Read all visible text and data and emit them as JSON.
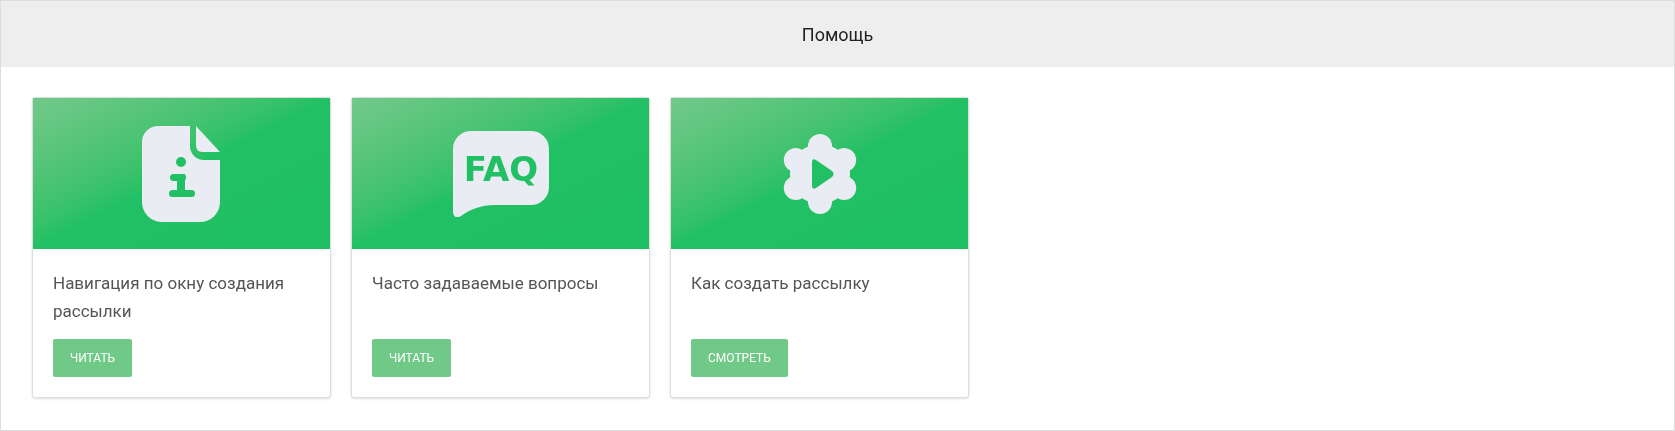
{
  "header": {
    "title": "Помощь"
  },
  "cards": [
    {
      "kind": "info",
      "title": "Навигация по окну создания рассылки",
      "button": "ЧИТАТЬ"
    },
    {
      "kind": "faq",
      "icon_label": "FAQ",
      "title": "Часто задаваемые вопросы",
      "button": "ЧИТАТЬ"
    },
    {
      "kind": "video",
      "title": "Как создать рассылку",
      "button": "СМОТРЕТЬ"
    }
  ]
}
